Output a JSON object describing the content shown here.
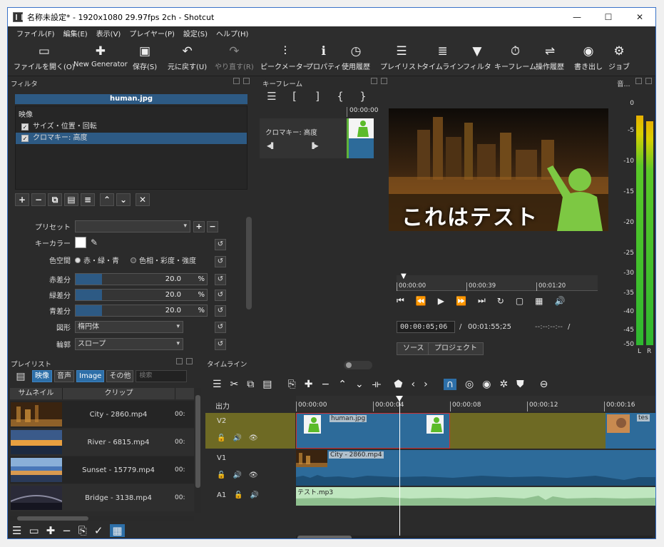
{
  "window": {
    "title": "名称未設定* - 1920x1080 29.97fps 2ch - Shotcut"
  },
  "menu": [
    "ファイル(F)",
    "編集(E)",
    "表示(V)",
    "プレイヤー(P)",
    "設定(S)",
    "ヘルプ(H)"
  ],
  "toolbar": {
    "open": "ファイルを開く(O)",
    "new_generator": "New Generator",
    "save": "保存(S)",
    "undo": "元に戻す(U)",
    "redo": "やり直す(R)",
    "peak_meter": "ピークメーター",
    "properties": "プロパティ",
    "recent": "使用履歴",
    "playlist": "プレイリスト",
    "timeline": "タイムライン",
    "filters": "フィルタ",
    "keyframes": "キーフレーム",
    "history": "操作履歴",
    "export": "書き出し",
    "jobs": "ジョブ"
  },
  "filters": {
    "panel_title": "フィルタ",
    "file": "human.jpg",
    "section": "映像",
    "items": [
      "サイズ・位置・回転",
      "クロマキー: 高度"
    ],
    "preset_label": "プリセット",
    "preset_value": "",
    "key_color_label": "キーカラー",
    "key_color": "#ffffff",
    "color_space_label": "色空間",
    "color_space_rgb": "赤・緑・青",
    "color_space_hsv": "色相・彩度・強度",
    "red_label": "赤差分",
    "red_value": "20.0",
    "green_label": "緑差分",
    "green_value": "20.0",
    "blue_label": "青差分",
    "blue_value": "20.0",
    "percent": "%",
    "slider_fraction": 0.2,
    "shape_label": "図形",
    "shape_value": "楕円体",
    "edge_label": "輪郭",
    "edge_value": "スロープ"
  },
  "keyframes": {
    "panel_title": "キーフレーム",
    "time": "00:00:00",
    "track": "クロマキー: 高度"
  },
  "player": {
    "caption": "これはテスト",
    "ruler": [
      "00:00:00",
      "00:00:39",
      "00:01:20"
    ],
    "timecode": "00:00:05;06",
    "separator": "/",
    "duration": "00:01:55;25",
    "in_out": "--:--:--:--",
    "tab_source": "ソース",
    "tab_project": "プロジェクト"
  },
  "meter": {
    "panel_title": "音...",
    "scale": [
      "0",
      "-5",
      "-10",
      "-15",
      "-20",
      "-25",
      "-30",
      "-35",
      "-40",
      "-45",
      "-50"
    ],
    "left": "L",
    "right": "R"
  },
  "playlist": {
    "panel_title": "プレイリスト",
    "tabs": [
      "映像",
      "音声",
      "Image",
      "その他"
    ],
    "search_placeholder": "検索",
    "col_thumb": "サムネイル",
    "col_clip": "クリップ",
    "rows": [
      {
        "clip": "City - 2860.mp4",
        "dur": "00:"
      },
      {
        "clip": "River - 6815.mp4",
        "dur": "00:"
      },
      {
        "clip": "Sunset - 15779.mp4",
        "dur": "00:"
      },
      {
        "clip": "Bridge - 3138.mp4",
        "dur": "00:"
      }
    ]
  },
  "timeline": {
    "panel_title": "タイムライン",
    "output": "出力",
    "ruler": [
      "00:00:00",
      "00:00:04",
      "00:00:08",
      "00:00:12",
      "00:00:16"
    ],
    "tracks": [
      "V2",
      "V1",
      "A1"
    ],
    "clip_v2": "human.jpg",
    "clip_v2_b": "tes",
    "clip_v1": "City - 2860.mp4",
    "clip_a1": "テスト.mp3"
  }
}
